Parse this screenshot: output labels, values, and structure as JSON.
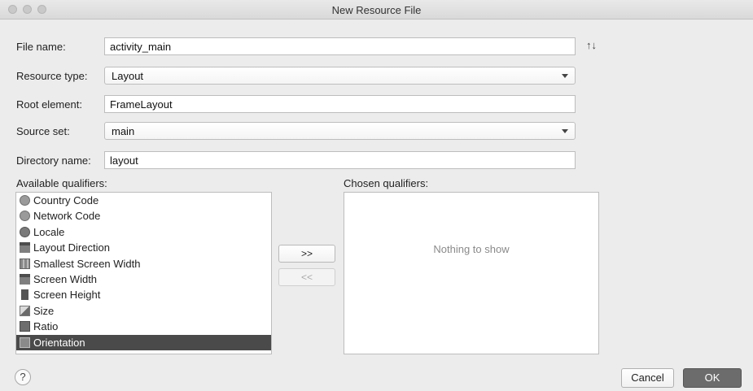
{
  "window": {
    "title": "New Resource File"
  },
  "form": {
    "file_name_label": "File name:",
    "file_name_value": "activity_main",
    "resource_type_label": "Resource type:",
    "resource_type_value": "Layout",
    "root_element_label": "Root element:",
    "root_element_value": "FrameLayout",
    "source_set_label": "Source set:",
    "source_set_value": "main",
    "directory_name_label": "Directory name:",
    "directory_name_value": "layout",
    "sort_icon": "↑↓"
  },
  "qualifiers": {
    "available_label": "Available qualifiers:",
    "chosen_label": "Chosen qualifiers:",
    "items": [
      {
        "label": "Country Code",
        "icon": "country-code-icon"
      },
      {
        "label": "Network Code",
        "icon": "network-code-icon"
      },
      {
        "label": "Locale",
        "icon": "locale-globe-icon"
      },
      {
        "label": "Layout Direction",
        "icon": "layout-direction-icon"
      },
      {
        "label": "Smallest Screen Width",
        "icon": "smallest-screen-width-icon"
      },
      {
        "label": "Screen Width",
        "icon": "screen-width-icon"
      },
      {
        "label": "Screen Height",
        "icon": "screen-height-icon"
      },
      {
        "label": "Size",
        "icon": "size-icon"
      },
      {
        "label": "Ratio",
        "icon": "ratio-icon"
      },
      {
        "label": "Orientation",
        "icon": "orientation-icon",
        "selected": true
      }
    ],
    "add_label": ">>",
    "remove_label": "<<",
    "empty_text": "Nothing to show"
  },
  "footer": {
    "help_label": "?",
    "cancel_label": "Cancel",
    "ok_label": "OK"
  }
}
